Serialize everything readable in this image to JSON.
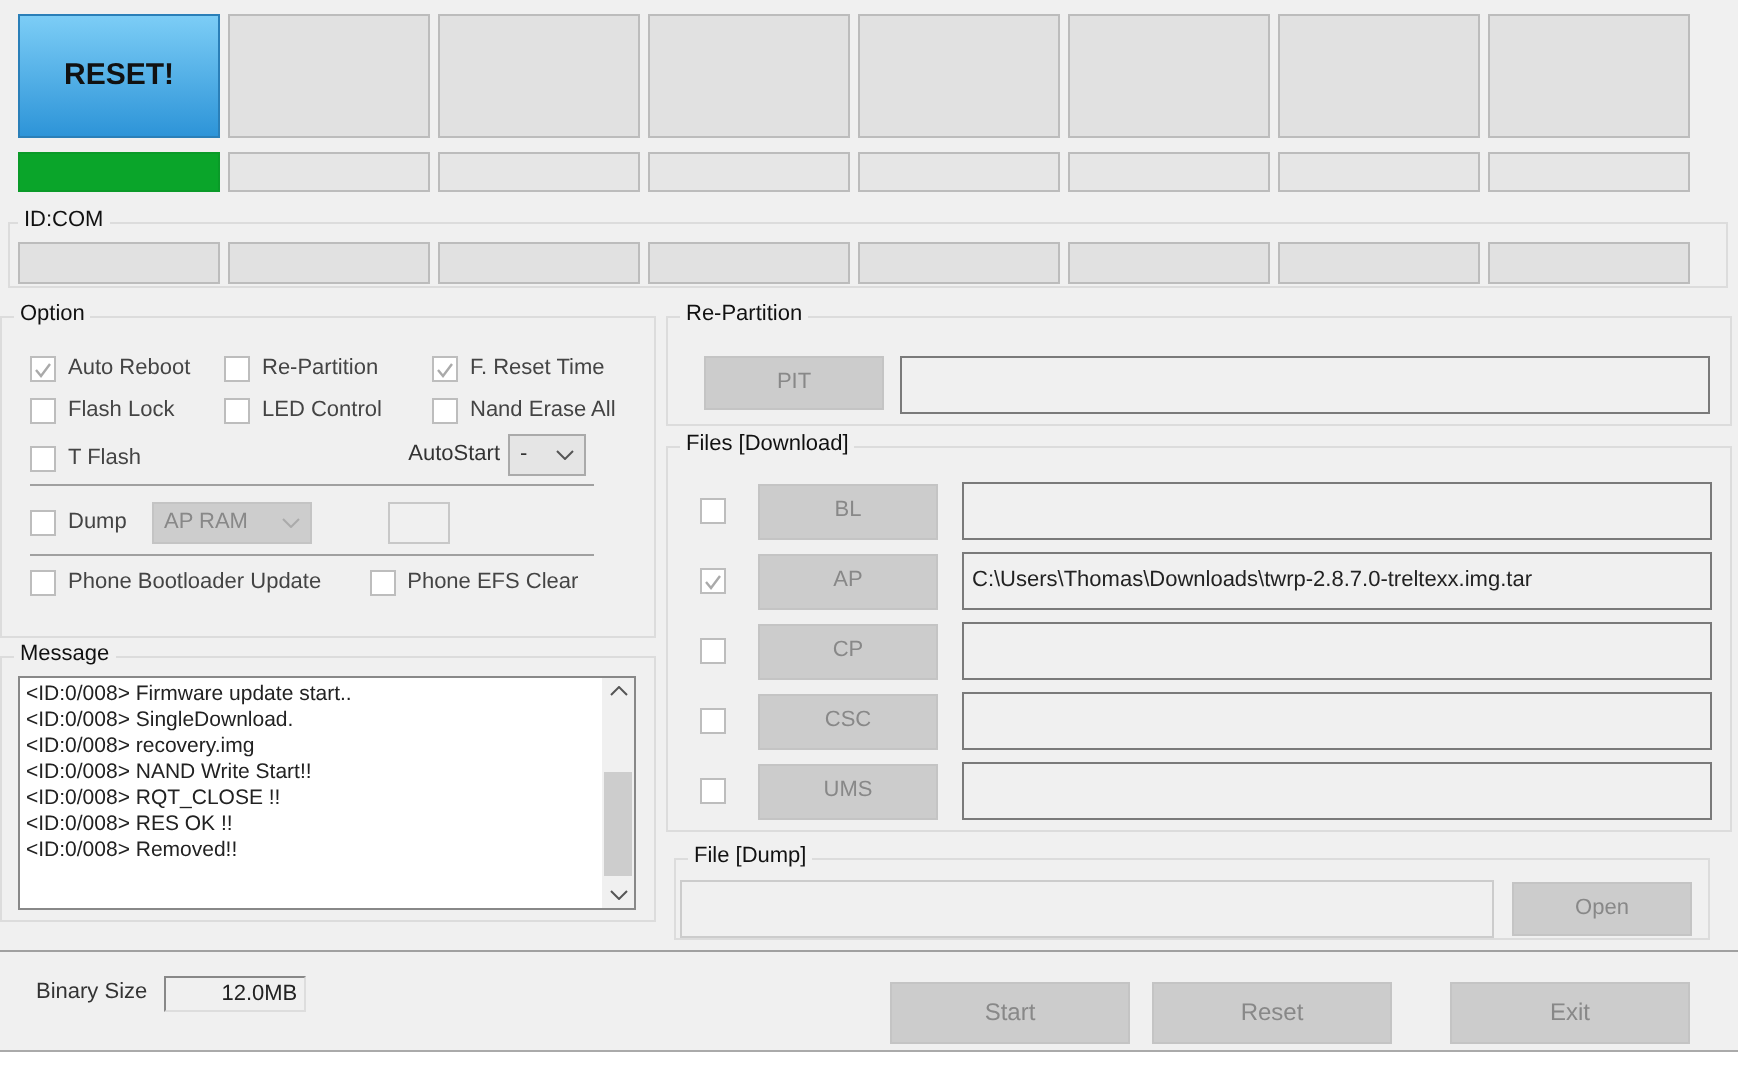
{
  "slots": [
    {
      "label": "RESET!",
      "complete": true
    },
    {
      "complete": false
    },
    {
      "complete": false
    },
    {
      "complete": false
    },
    {
      "complete": false
    },
    {
      "complete": false
    },
    {
      "complete": false
    },
    {
      "complete": false
    }
  ],
  "id_com": {
    "title": "ID:COM"
  },
  "option": {
    "title": "Option",
    "checkboxes": [
      {
        "label": "Auto Reboot",
        "checked": true
      },
      {
        "label": "Re-Partition",
        "checked": false
      },
      {
        "label": "F. Reset Time",
        "checked": true
      },
      {
        "label": "Flash Lock",
        "checked": false
      },
      {
        "label": "LED Control",
        "checked": false
      },
      {
        "label": "Nand Erase All",
        "checked": false
      },
      {
        "label": "T Flash",
        "checked": false
      }
    ],
    "autostart": {
      "label": "AutoStart",
      "value": "-"
    },
    "dump": {
      "label": "Dump",
      "checked": false,
      "select": "AP RAM"
    },
    "phone": [
      {
        "label": "Phone Bootloader Update",
        "checked": false
      },
      {
        "label": "Phone EFS Clear",
        "checked": false
      }
    ]
  },
  "message": {
    "title": "Message",
    "lines": [
      "<ID:0/008> Firmware update start..",
      "<ID:0/008> SingleDownload.",
      "<ID:0/008> recovery.img",
      "<ID:0/008> NAND Write Start!!",
      "<ID:0/008> RQT_CLOSE !!",
      "<ID:0/008> RES OK !!",
      "<ID:0/008> Removed!!"
    ]
  },
  "binary_size": {
    "label": "Binary Size",
    "value": "12.0MB"
  },
  "repartition": {
    "title": "Re-Partition",
    "button": "PIT"
  },
  "files": {
    "title": "Files [Download]",
    "rows": [
      {
        "button": "BL",
        "checked": false
      },
      {
        "button": "AP",
        "checked": true,
        "path": "C:\\Users\\Thomas\\Downloads\\twrp-2.8.7.0-treltexx.img.tar"
      },
      {
        "button": "CP",
        "checked": false
      },
      {
        "button": "CSC",
        "checked": false
      },
      {
        "button": "UMS",
        "checked": false
      }
    ]
  },
  "dump_file": {
    "title": "File [Dump]",
    "button": "Open"
  },
  "buttons": [
    "Start",
    "Reset",
    "Exit"
  ]
}
